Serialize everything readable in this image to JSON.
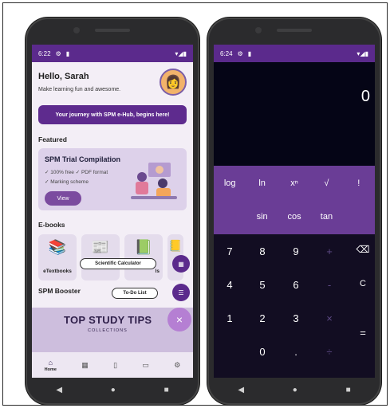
{
  "left_phone": {
    "status": {
      "time": "6:22",
      "icons": [
        "gear-icon",
        "sim-icon"
      ],
      "right": "▾◢▮"
    },
    "greeting": "Hello, Sarah",
    "subtitle": "Make learning fun and awesome.",
    "journey_button": "Your journey with SPM e-Hub, begins here!",
    "featured_title": "Featured",
    "trial": {
      "title": "SPM Trial Compilation",
      "bullet1": "✓ 100% free  ✓ PDF format",
      "bullet2": "✓ Marking scheme",
      "view_label": "View"
    },
    "ebooks_title": "E-books",
    "ebooks": [
      {
        "label": "eTextbooks",
        "icon": "📚"
      },
      {
        "label": "",
        "icon": "📰"
      },
      {
        "label": "ls",
        "icon": "📗"
      },
      {
        "label": "",
        "icon": "📒"
      }
    ],
    "tooltip_calculator": "Scientific Calculator",
    "tooltip_todo": "To-Do List",
    "booster_title": "SPM Booster",
    "booster_banner_big": "TOP STUDY TIPS",
    "booster_banner_small": "COLLECTIONS",
    "fab_close": "×",
    "bottom_nav": [
      {
        "icon": "⌂",
        "label": "Home"
      },
      {
        "icon": "▦",
        "label": ""
      },
      {
        "icon": "▯",
        "label": ""
      },
      {
        "icon": "▭",
        "label": ""
      },
      {
        "icon": "⚙",
        "label": ""
      }
    ]
  },
  "right_phone": {
    "status": {
      "time": "6:24",
      "right": "▾◢▮"
    },
    "display_value": "0",
    "sci_row1": [
      "log",
      "ln",
      "xⁿ",
      "√",
      "!"
    ],
    "sci_row2": [
      "sin",
      "cos",
      "tan"
    ],
    "numpad": {
      "r1": [
        "7",
        "8",
        "9",
        "+",
        "⌫"
      ],
      "r2": [
        "4",
        "5",
        "6",
        "-",
        "C"
      ],
      "r3": [
        "1",
        "2",
        "3",
        "×",
        "="
      ],
      "r4": [
        "0",
        ".",
        "÷"
      ]
    }
  },
  "nav": {
    "back": "◀",
    "home": "●",
    "recents": "■"
  },
  "colors": {
    "accent": "#5b2a8c",
    "calc_dark": "#120d22",
    "sci_panel": "#6a3d96"
  }
}
